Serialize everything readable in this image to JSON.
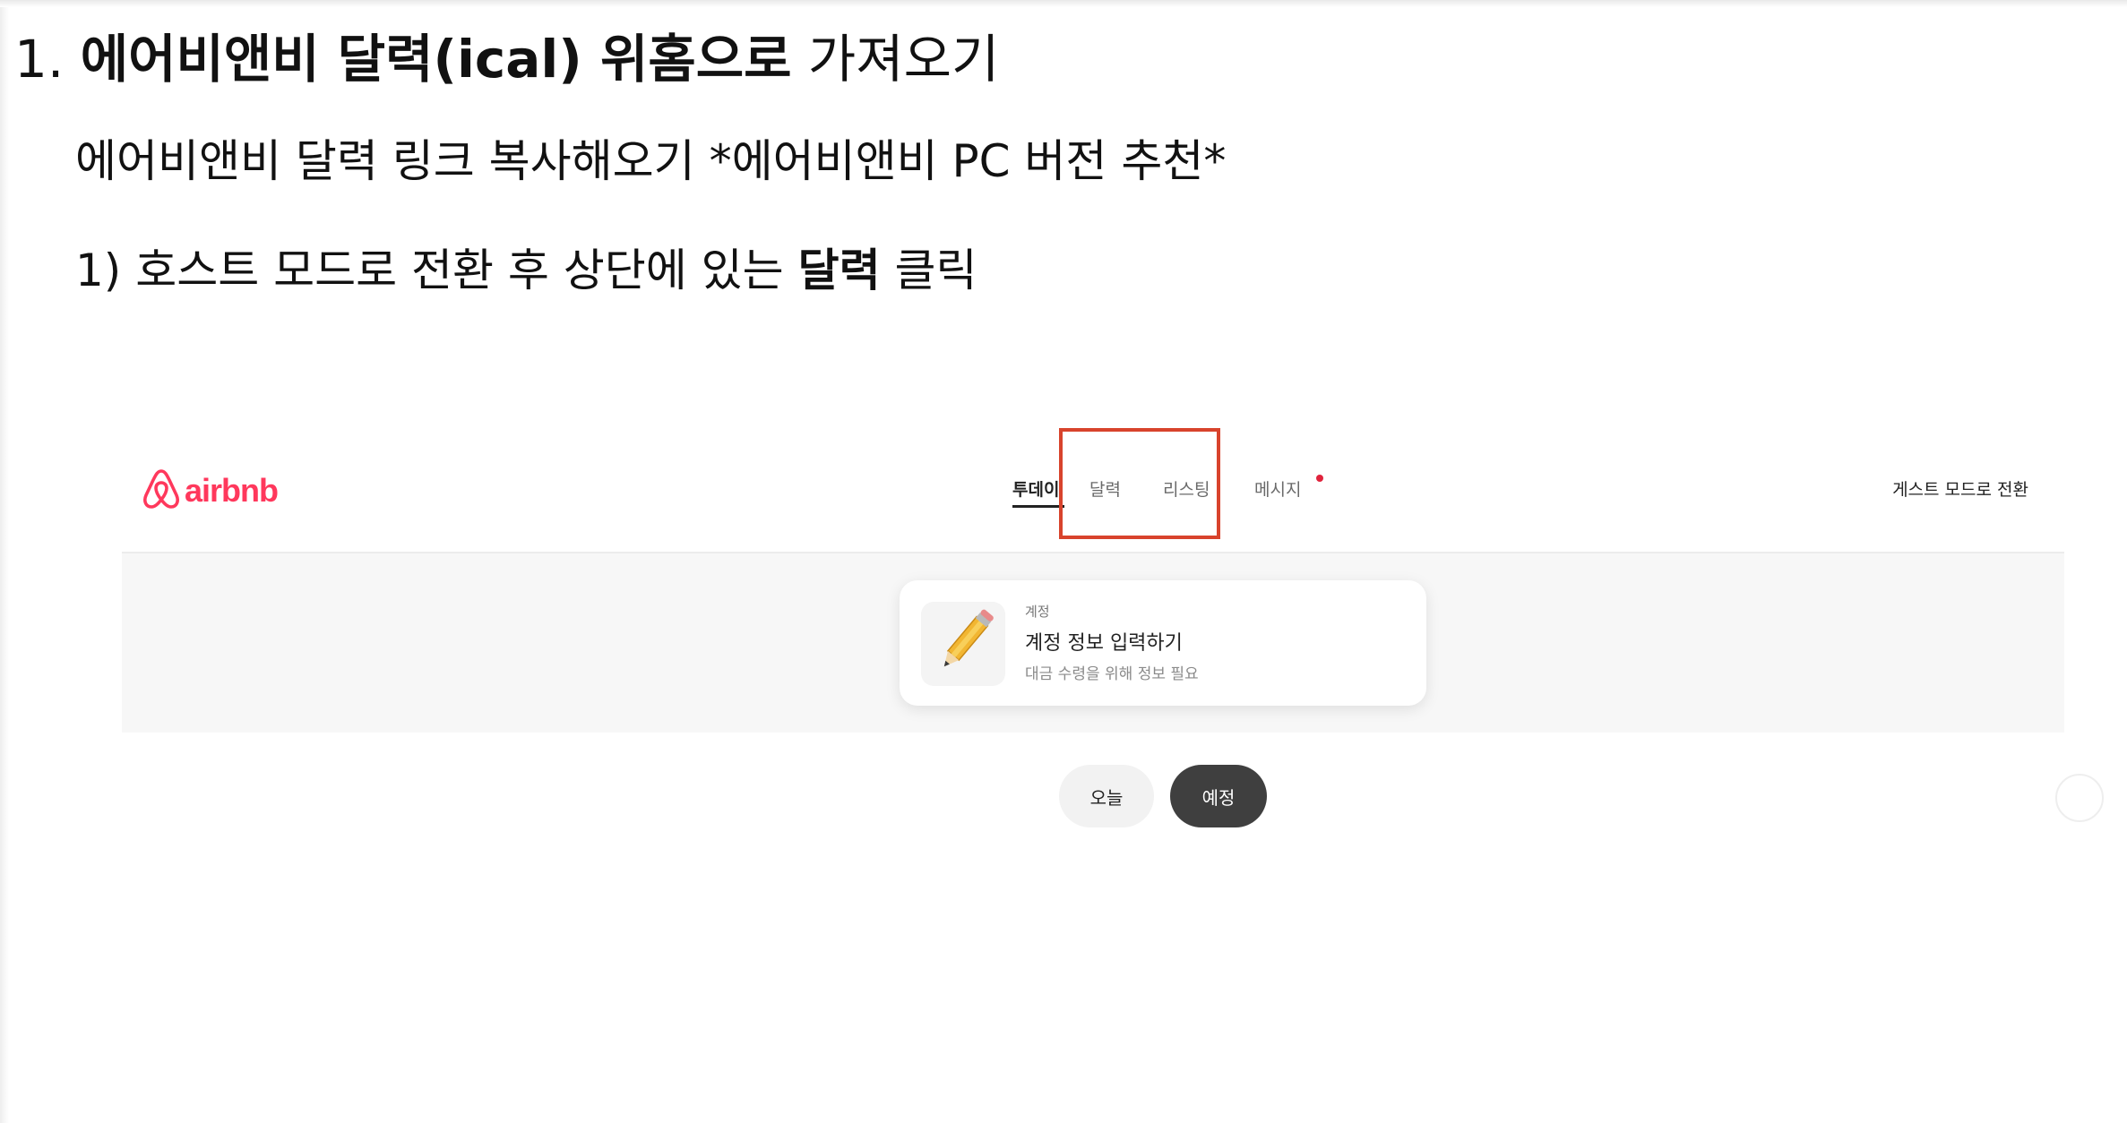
{
  "doc": {
    "heading_number": "1.",
    "heading_bold": "에어비앤비 달력(ical) 위홈으로",
    "heading_rest": "가져오기",
    "subtitle": "에어비앤비 달력 링크 복사해오기 *에어비앤비 PC 버전 추천*",
    "step_prefix": "1) 호스트 모드로 전환 후 상단에 있는",
    "step_bold": "달력",
    "step_suffix": "클릭"
  },
  "airbnb": {
    "logo_text": "airbnb",
    "brand_color": "#ff385c",
    "nav": {
      "today": "투데이",
      "calendar": "달력",
      "listings": "리스팅",
      "messages": "메시지"
    },
    "guest_mode_link": "게스트 모드로 전환",
    "card": {
      "kicker": "계정",
      "title": "계정 정보 입력하기",
      "description": "대금 수령을 위해 정보 필요"
    },
    "pills": {
      "today": "오늘",
      "upcoming": "예정"
    },
    "highlight_color": "#d8432c"
  }
}
